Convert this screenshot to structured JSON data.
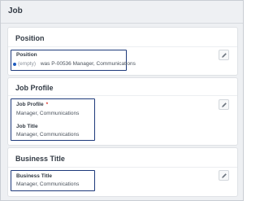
{
  "page": {
    "title": "Job"
  },
  "sections": {
    "position": {
      "title": "Position",
      "field_label": "Position",
      "empty_text": "(empty)",
      "was_text": "was P-00536 Manager, Communications",
      "edit_icon": "pencil-icon"
    },
    "job_profile": {
      "title": "Job Profile",
      "job_profile_label": "Job Profile",
      "required_marker": "*",
      "job_profile_value": "Manager, Communications",
      "job_title_label": "Job Title",
      "job_title_value": "Manager, Communications",
      "edit_icon": "pencil-icon"
    },
    "business_title": {
      "title": "Business Title",
      "field_label": "Business Title",
      "field_value": "Manager, Communications",
      "edit_icon": "pencil-icon"
    }
  },
  "colors": {
    "highlight_border": "#1e3a7b",
    "required": "#d93025",
    "changed_dot": "#1e5bbf"
  }
}
